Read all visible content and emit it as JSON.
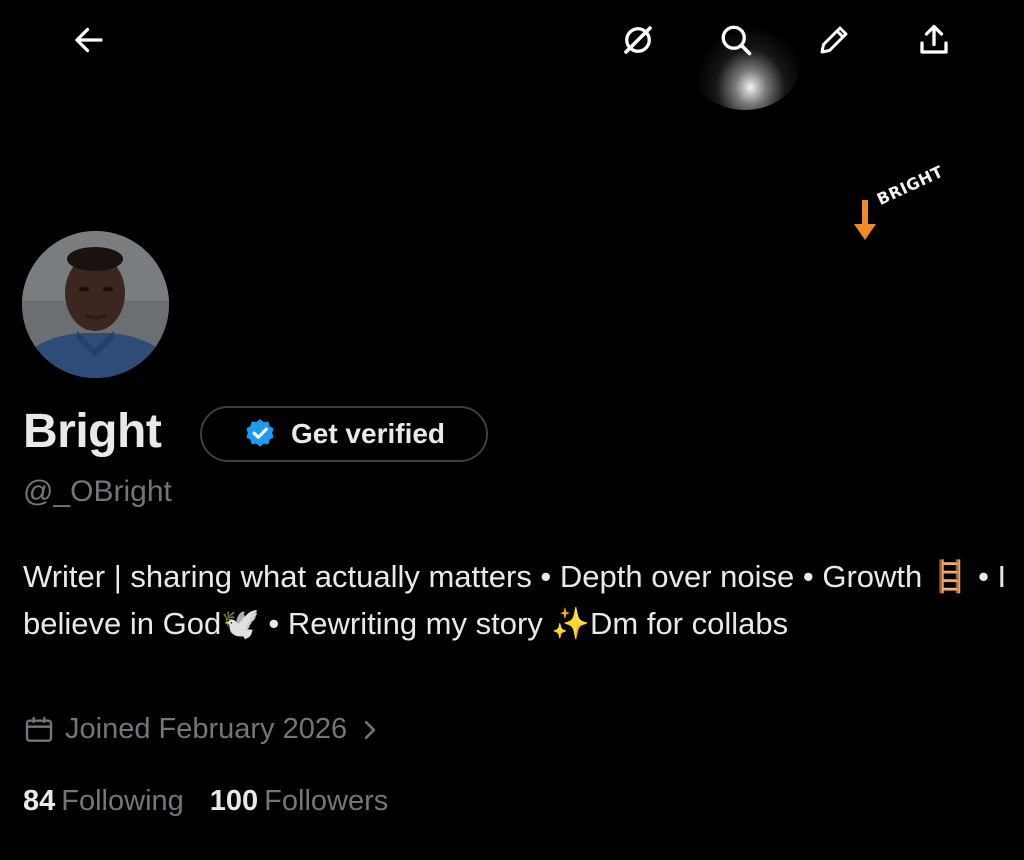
{
  "topbar": {
    "icons": [
      "back-arrow-icon",
      "grok-icon",
      "search-icon",
      "edit-pencil-icon",
      "share-upload-icon"
    ]
  },
  "banner": {
    "sticker_text": "BRIGHT",
    "arrow_color": "#f08a24"
  },
  "profile": {
    "name": "Bright",
    "verify_button": "Get verified",
    "handle": "@_OBright",
    "bio": "Writer | sharing what actually matters • Depth over noise • Growth 🪜 • I believe in God🕊️ • Rewriting my story ✨Dm for collabs",
    "joined": "Joined February 2026",
    "following_count": "84",
    "following_label": "Following",
    "followers_count": "100",
    "followers_label": "Followers"
  },
  "colors": {
    "background": "#000000",
    "primary_text": "#e7e9ea",
    "secondary_text": "#71767b",
    "verified_blue": "#1d9bf0",
    "pill_border": "#3a3f44"
  }
}
